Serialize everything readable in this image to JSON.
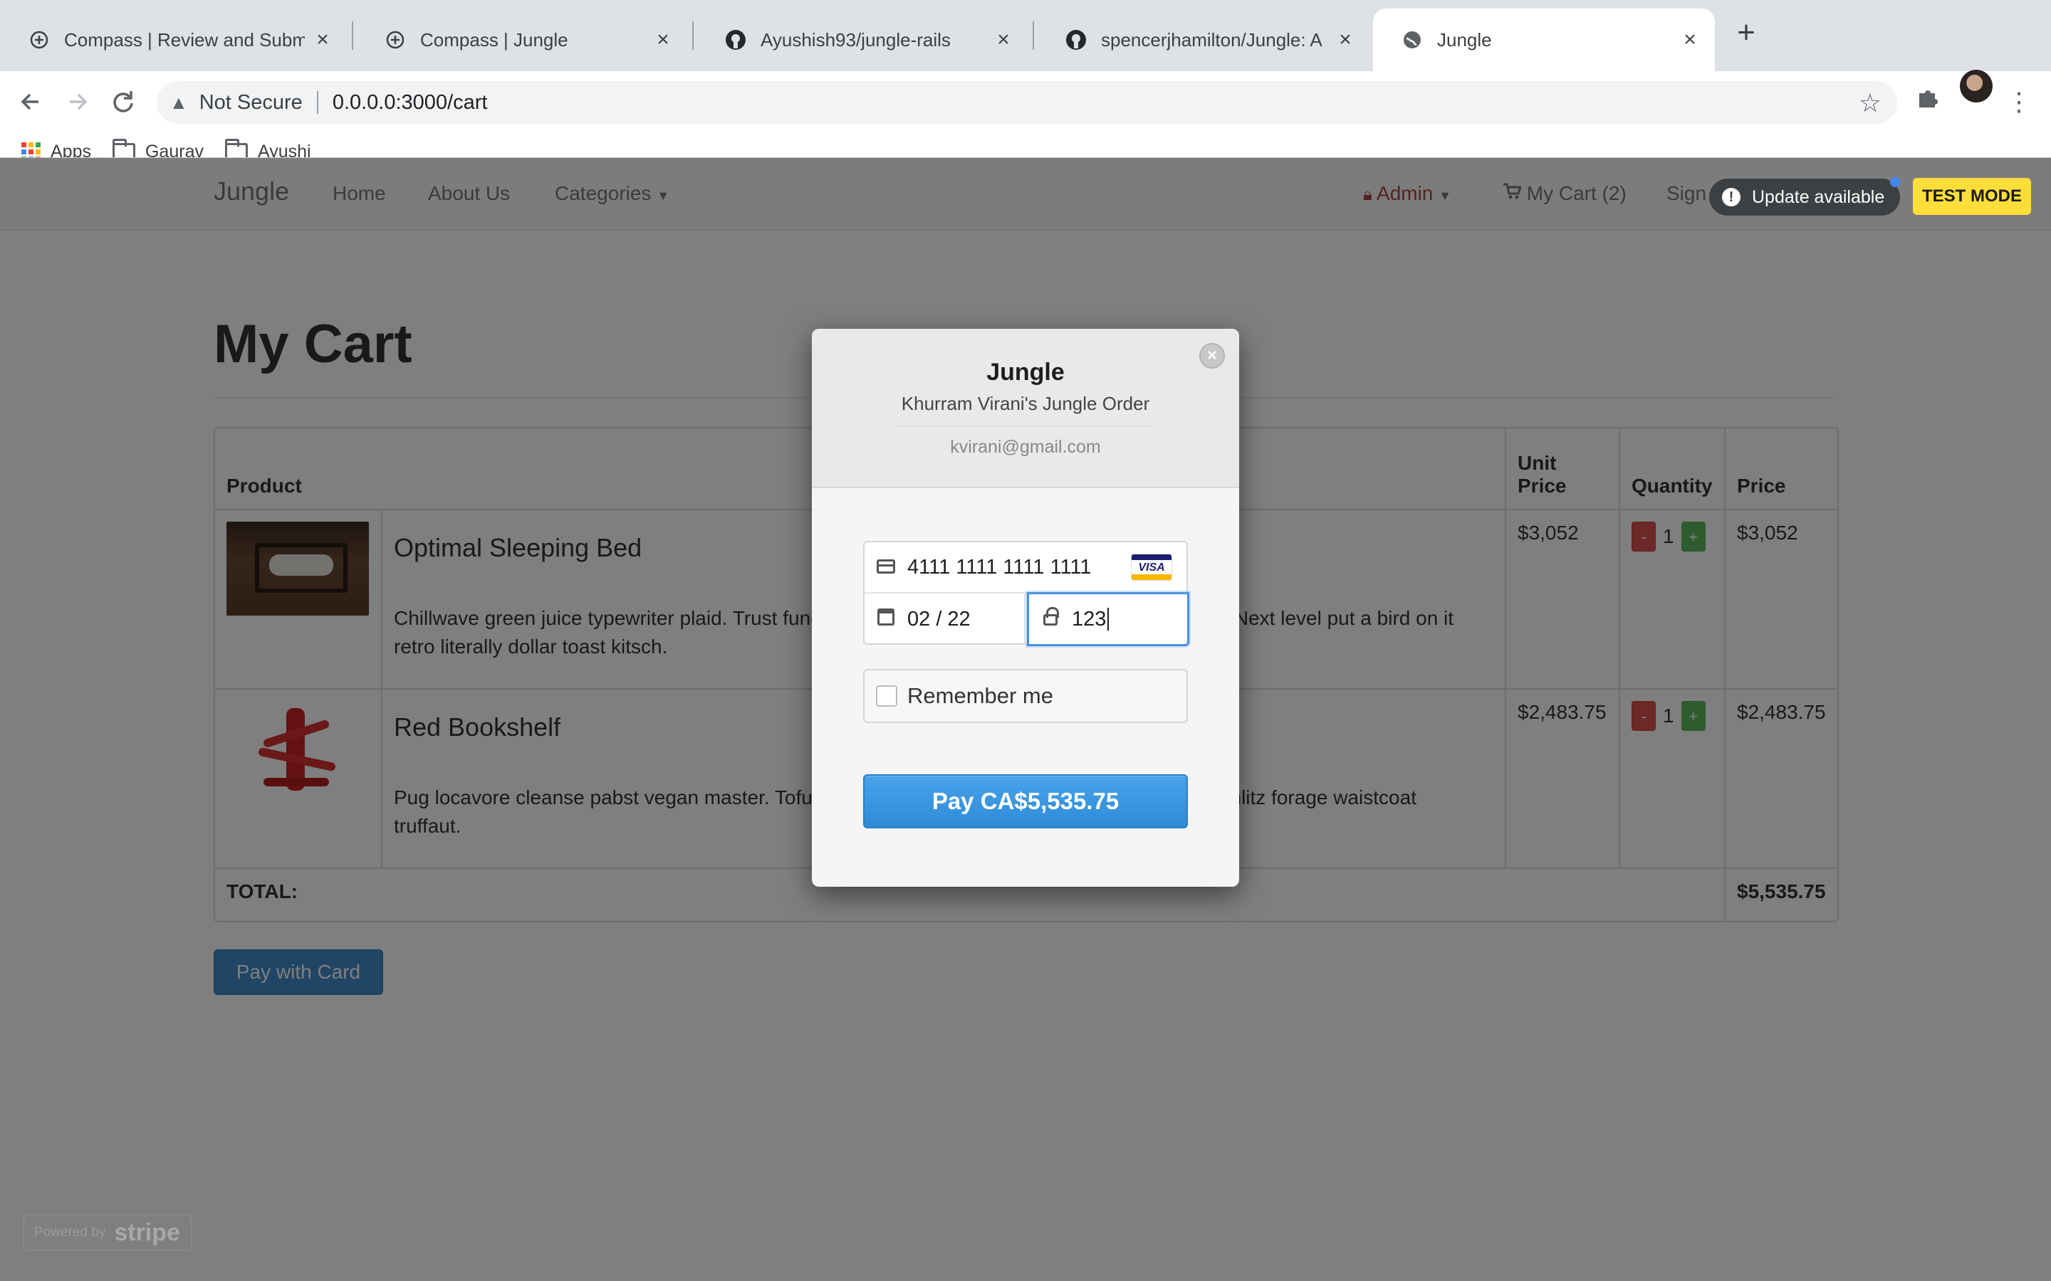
{
  "browser": {
    "tabs": [
      {
        "title": "Compass | Review and Submit"
      },
      {
        "title": "Compass | Jungle"
      },
      {
        "title": "Ayushish93/jungle-rails"
      },
      {
        "title": "spencerjhamilton/Jungle: A mini"
      },
      {
        "title": "Jungle"
      }
    ],
    "security_label": "Not Secure",
    "url": "0.0.0.0:3000/cart",
    "bookmarks": [
      "Apps",
      "Gaurav",
      "Ayushi"
    ]
  },
  "nav": {
    "brand": "Jungle",
    "home": "Home",
    "about": "About Us",
    "categories": "Categories",
    "admin": "Admin",
    "cart": "My Cart (2)",
    "signup": "Sign Up"
  },
  "notifications": {
    "update": "Update available",
    "test_mode": "TEST MODE"
  },
  "page": {
    "title": "My Cart",
    "pay_with_card": "Pay with Card",
    "powered_by": "Powered by",
    "stripe_word": "stripe"
  },
  "cart": {
    "headers": {
      "product": "Product",
      "unit_price": "Unit Price",
      "quantity": "Quantity",
      "price": "Price"
    },
    "items": [
      {
        "name": "Optimal Sleeping Bed",
        "description": "Chillwave green juice typewriter plaid. Trust fund Truffaut 90's gluten-free cornhole kitsch plaid. Next level put a bird on it retro literally dollar toast kitsch.",
        "unit_price": "$3,052",
        "quantity": "1",
        "price": "$3,052"
      },
      {
        "name": "Red Bookshelf",
        "description": "Pug locavore cleanse pabst vegan master. Tofu Etsy portland. Stumptown mlkshk tofu. Cray schlitz forage waistcoat truffaut.",
        "unit_price": "$2,483.75",
        "quantity": "1",
        "price": "$2,483.75"
      }
    ],
    "minus": "-",
    "plus": "+",
    "total_label": "TOTAL:",
    "total_value": "$5,535.75"
  },
  "checkout": {
    "merchant": "Jungle",
    "description": "Khurram Virani's Jungle Order",
    "email": "kvirani@gmail.com",
    "card_number": "4111 1111 1111 1111",
    "card_brand": "VISA",
    "expiry": "02 / 22",
    "cvc": "123",
    "remember_me": "Remember me",
    "pay_button": "Pay CA$5,535.75"
  },
  "colors": {
    "pay_button": "#2f8bd6",
    "test_mode": "#ffde39",
    "admin": "#a94442"
  }
}
